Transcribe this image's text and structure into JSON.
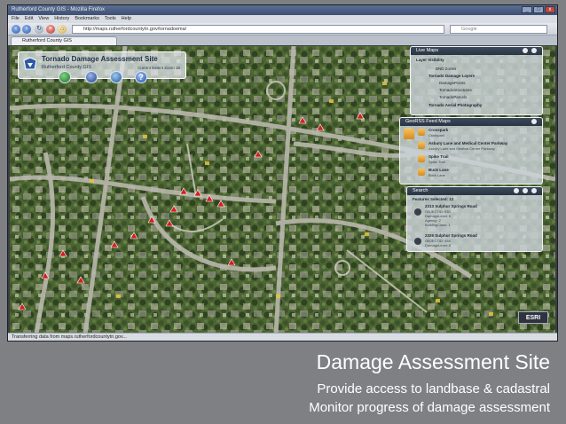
{
  "browser": {
    "window_title": "Rutherford County GIS - Mozilla Firefox",
    "menu": [
      "File",
      "Edit",
      "View",
      "History",
      "Bookmarks",
      "Tools",
      "Help"
    ],
    "url": "http://maps.rutherfordcountytn.gov/tornadoema/",
    "search_placeholder": "Google",
    "tab_label": "Rutherford County GIS",
    "status": "Transferring data from maps.rutherfordcountytn.gov..."
  },
  "app": {
    "title": "Tornado Damage Assessment Site",
    "subtitle": "Rutherford County GIS",
    "coords": "Current Extent Zoom 16"
  },
  "layers_panel": {
    "title": "Live Maps",
    "subtitle": "Layer Visibility",
    "items": [
      "BND Zones",
      "Tornado Damage Layers",
      "DamagePoints",
      "TornadoStructures",
      "TornadoParcels",
      "Tornado Aerial Photography"
    ]
  },
  "feeds_panel": {
    "title": "GeoRSS Feed Maps",
    "items": [
      {
        "title": "Crosspark",
        "sub": "Crosspark"
      },
      {
        "title": "Asbury Lane and Medical Center Parkway",
        "sub": "Asbury Lane and Medical Center Parkway"
      },
      {
        "title": "Spike Trail",
        "sub": "Spike Trail"
      },
      {
        "title": "Buck Lane",
        "sub": "Buck Lane"
      }
    ]
  },
  "search_panel": {
    "title": "Search",
    "selected": "Features Selected: 12",
    "results": [
      {
        "title": "2313 Sulphur Springs Road",
        "lines": [
          "OBJECTID: 530",
          "DamageLevel: 6",
          "Agency: 2",
          "BuildingClass: 1"
        ]
      },
      {
        "title": "2326 Sulphur Springs Road",
        "lines": [
          "OBJECTID: 458",
          "DamageLevel: 6"
        ]
      }
    ]
  },
  "esri_label": "ESRI",
  "caption": {
    "title": "Damage Assessment Site",
    "line1": "Provide access to landbase & cadastral",
    "line2": "Monitor progress of damage assessment"
  },
  "colors": {
    "background": "#7e8084",
    "panel_header": "#2a3543",
    "damage_marker": "#d22020",
    "feed_icon": "#e8a12e"
  }
}
